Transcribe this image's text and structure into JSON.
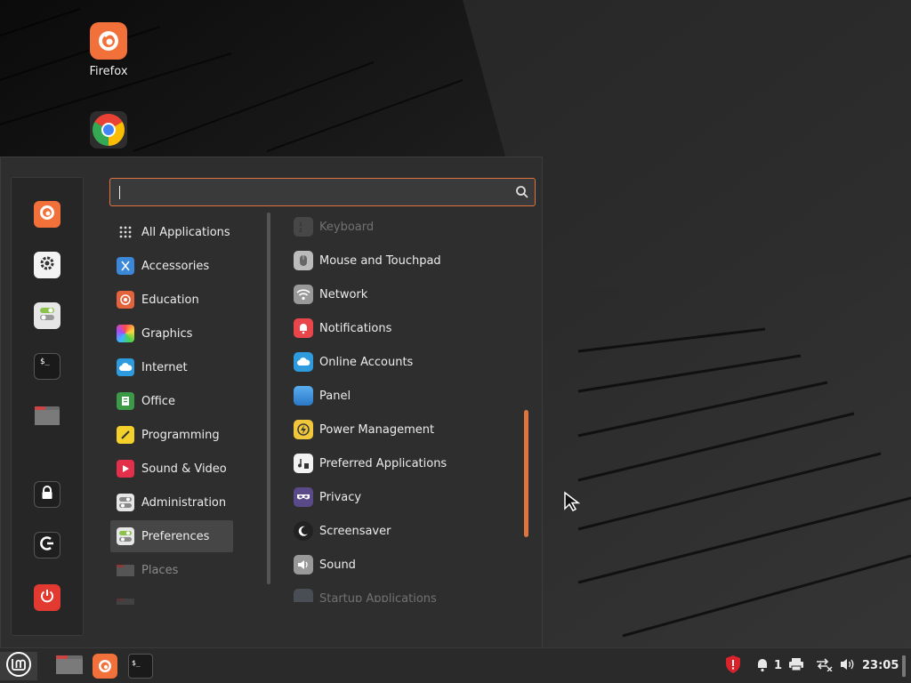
{
  "desktop": {
    "icons": [
      {
        "label": "Firefox",
        "icon": "firefox-icon"
      },
      {
        "label": "",
        "icon": "chrome-icon"
      }
    ]
  },
  "menu": {
    "search": {
      "value": "",
      "placeholder": ""
    },
    "favorites": [
      {
        "icon": "firefox-icon"
      },
      {
        "icon": "settings-icon"
      },
      {
        "icon": "toggles-icon"
      },
      {
        "icon": "terminal-icon"
      },
      {
        "icon": "folder-icon"
      },
      {
        "icon": "lock-icon"
      },
      {
        "icon": "logout-icon"
      },
      {
        "icon": "power-icon"
      }
    ],
    "categories": [
      {
        "label": "All Applications",
        "icon": "grid-icon"
      },
      {
        "label": "Accessories",
        "icon": "scissors-icon"
      },
      {
        "label": "Education",
        "icon": "education-icon"
      },
      {
        "label": "Graphics",
        "icon": "graphics-icon"
      },
      {
        "label": "Internet",
        "icon": "cloud-icon"
      },
      {
        "label": "Office",
        "icon": "office-icon"
      },
      {
        "label": "Programming",
        "icon": "programming-icon"
      },
      {
        "label": "Sound & Video",
        "icon": "play-icon"
      },
      {
        "label": "Administration",
        "icon": "toggles-icon"
      },
      {
        "label": "Preferences",
        "icon": "toggles-icon",
        "active": true
      },
      {
        "label": "Places",
        "icon": "folder-icon"
      }
    ],
    "apps": [
      {
        "label": "Keyboard",
        "icon": "keyboard-icon"
      },
      {
        "label": "Mouse and Touchpad",
        "icon": "mouse-icon"
      },
      {
        "label": "Network",
        "icon": "wifi-icon"
      },
      {
        "label": "Notifications",
        "icon": "bell-icon"
      },
      {
        "label": "Online Accounts",
        "icon": "cloud-icon"
      },
      {
        "label": "Panel",
        "icon": "panel-icon"
      },
      {
        "label": "Power Management",
        "icon": "power-management-icon"
      },
      {
        "label": "Preferred Applications",
        "icon": "music-file-icon"
      },
      {
        "label": "Privacy",
        "icon": "privacy-mask-icon"
      },
      {
        "label": "Screensaver",
        "icon": "moon-icon"
      },
      {
        "label": "Sound",
        "icon": "speaker-icon"
      },
      {
        "label": "Startup Applications",
        "icon": "startup-icon"
      }
    ]
  },
  "panel": {
    "notification_count": "1",
    "clock": "23:05"
  },
  "colors": {
    "accent": "#e0743e",
    "menu_bg": "#2e2e2e",
    "panel_bg": "#2a2a2a"
  }
}
